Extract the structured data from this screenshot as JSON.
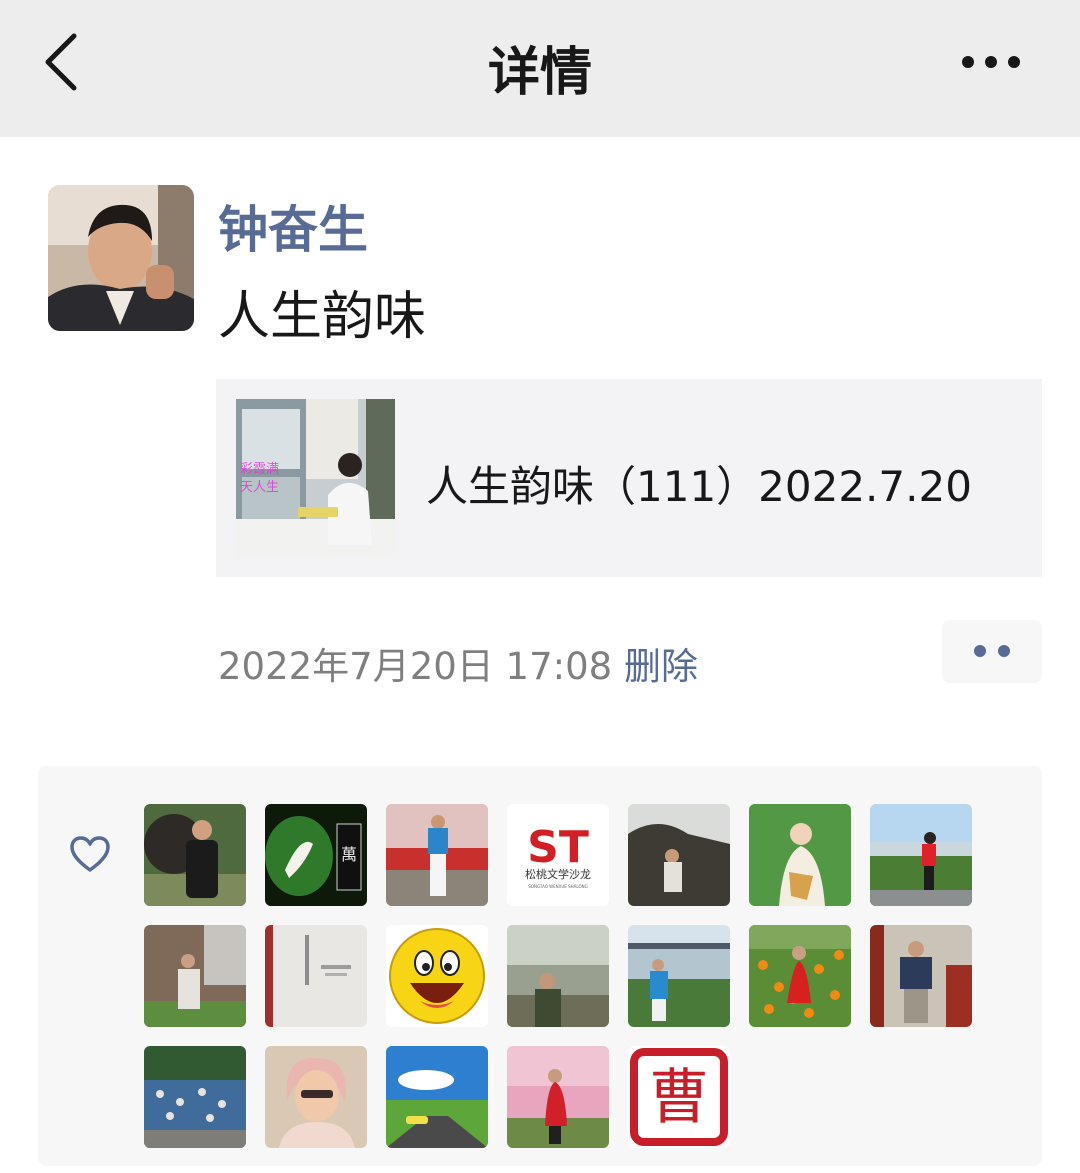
{
  "navbar": {
    "title": "详情",
    "back_icon": "chevron-left-icon",
    "more_icon": "more-dots-icon"
  },
  "post": {
    "author": "钟奋生",
    "text": "人生韵味",
    "link": {
      "title": "人生韵味（111）2022.7.20"
    },
    "time": "2022年7月20日 17:08",
    "delete_label": "删除"
  },
  "likes": {
    "icon": "heart-outline-icon",
    "avatars": [
      "liker-avatar",
      "liker-avatar",
      "liker-avatar",
      "liker-avatar",
      "liker-avatar",
      "liker-avatar",
      "liker-avatar",
      "liker-avatar",
      "liker-avatar",
      "liker-avatar",
      "liker-avatar",
      "liker-avatar",
      "liker-avatar",
      "liker-avatar",
      "liker-avatar",
      "liker-avatar",
      "liker-avatar",
      "liker-avatar",
      "liker-avatar"
    ],
    "logo_text": "ST",
    "logo_caption": "松桃文学沙龙",
    "logo_sub": "SONGTAO WENXUE SHALONG",
    "seal_char": "曹"
  },
  "colors": {
    "nav_bg": "#ededed",
    "link_blue": "#576b95",
    "panel_bg": "#f7f7f7",
    "card_bg": "#f3f3f5"
  }
}
